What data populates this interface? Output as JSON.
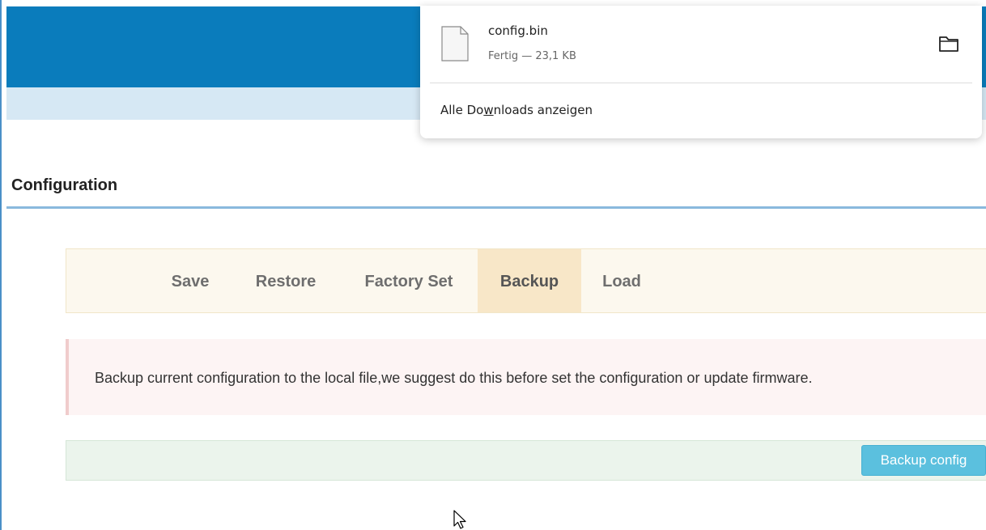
{
  "page": {
    "title": "Configuration"
  },
  "tabs": [
    {
      "label": "Save",
      "active": false
    },
    {
      "label": "Restore",
      "active": false
    },
    {
      "label": "Factory Set",
      "active": false
    },
    {
      "label": "Backup",
      "active": true
    },
    {
      "label": "Load",
      "active": false
    }
  ],
  "notice": {
    "text": "Backup current configuration to the local file,we suggest do this before set the configuration or update firmware."
  },
  "actions": {
    "backup_label": "Backup config"
  },
  "downloads": {
    "file_name": "config.bin",
    "file_status": "Fertig — 23,1 KB",
    "show_all_before": "Alle Do",
    "show_all_accesskey": "w",
    "show_all_after": "nloads anzeigen"
  },
  "icons": {
    "file": "file-icon",
    "folder": "folder-icon",
    "cursor": "mouse-pointer-icon"
  },
  "colors": {
    "header": "#0a7cbc",
    "subheader": "#d6e8f4",
    "tab_active": "#f8e7c8",
    "button": "#5bc0de"
  }
}
